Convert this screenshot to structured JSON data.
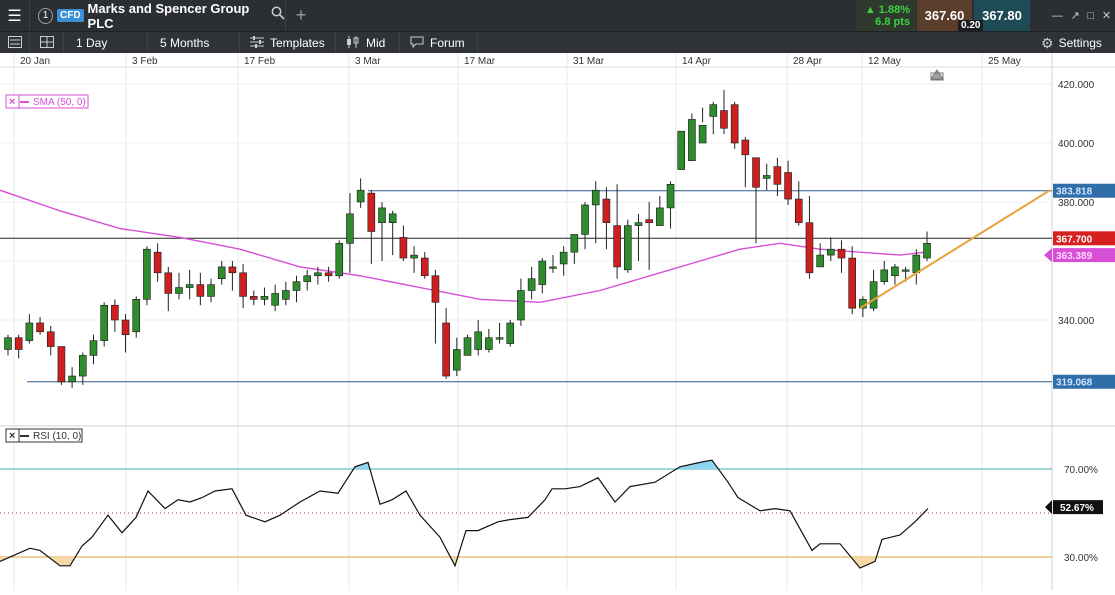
{
  "instrument": {
    "order": "1",
    "badge": "CFD",
    "name": "Marks and Spencer Group PLC"
  },
  "quote": {
    "change_pct": "1.88%",
    "change_pts": "6.8 pts",
    "sell": "367.60",
    "buy": "367.80",
    "spread": "0.20"
  },
  "toolbar": {
    "interval": "1 Day",
    "range": "5 Months",
    "templates": "Templates",
    "price_type": "Mid",
    "forum": "Forum",
    "settings": "Settings"
  },
  "colors": {
    "up": "#2e8b2e",
    "down": "#cc2020",
    "sma": "#d64fd6",
    "trendline": "#e8a23a",
    "overbought": "#8fd3f0",
    "oversold": "#f7d9a8"
  },
  "x_axis": [
    "20 Jan",
    "3 Feb",
    "17 Feb",
    "3 Mar",
    "17 Mar",
    "31 Mar",
    "14 Apr",
    "28 Apr",
    "12 May",
    "25 May"
  ],
  "price_axis": [
    "420.000",
    "400.000",
    "380.000",
    "340.000"
  ],
  "price_labels": {
    "current": "367.700",
    "upper_line": "383.818",
    "sma": "363.389",
    "lower_line": "319.068"
  },
  "sma_legend": "SMA (50, 0)",
  "rsi_legend": "RSI (10, 0)",
  "rsi_axis": [
    "70.00%",
    "30.00%"
  ],
  "rsi_current": "52.67%",
  "chart_data": {
    "type": "candlestick",
    "ylim": [
      310,
      426
    ],
    "candles": [
      [
        330,
        334,
        328,
        335
      ],
      [
        334,
        330,
        327,
        335
      ],
      [
        333,
        339,
        332,
        342
      ],
      [
        339,
        336,
        335,
        341
      ],
      [
        336,
        331,
        328,
        338
      ],
      [
        331,
        319,
        318,
        331
      ],
      [
        319,
        321,
        317,
        324
      ],
      [
        321,
        328,
        318,
        329
      ],
      [
        328,
        333,
        325,
        335
      ],
      [
        333,
        345,
        331,
        346
      ],
      [
        345,
        340,
        336,
        347
      ],
      [
        340,
        335,
        329,
        342
      ],
      [
        336,
        347,
        334,
        348
      ],
      [
        347,
        364,
        345,
        365
      ],
      [
        363,
        356,
        353,
        366
      ],
      [
        356,
        349,
        343,
        358
      ],
      [
        349,
        351,
        347,
        356
      ],
      [
        351,
        352,
        347,
        357
      ],
      [
        352,
        348,
        345,
        356
      ],
      [
        348,
        352,
        346,
        354
      ],
      [
        354,
        358,
        352,
        360
      ],
      [
        358,
        356,
        350,
        360
      ],
      [
        356,
        348,
        344,
        359
      ],
      [
        348,
        347,
        345,
        350
      ],
      [
        347,
        348,
        345,
        351
      ],
      [
        345,
        349,
        343,
        352
      ],
      [
        347,
        350,
        345,
        353
      ],
      [
        350,
        353,
        346,
        355
      ],
      [
        353,
        355,
        350,
        357
      ],
      [
        355,
        356,
        352,
        358
      ],
      [
        356,
        355,
        353,
        358
      ],
      [
        355,
        366,
        354,
        367
      ],
      [
        366,
        376,
        356,
        383
      ],
      [
        380,
        384,
        378,
        388
      ],
      [
        383,
        370,
        359,
        384
      ],
      [
        373,
        378,
        360,
        380
      ],
      [
        373,
        376,
        362,
        377
      ],
      [
        368,
        361,
        360,
        372
      ],
      [
        361,
        362,
        356,
        365
      ],
      [
        361,
        355,
        354,
        363
      ],
      [
        355,
        346,
        332,
        357
      ],
      [
        339,
        321,
        320,
        344
      ],
      [
        323,
        330,
        321,
        334
      ],
      [
        328,
        334,
        328,
        335
      ],
      [
        330,
        336,
        328,
        340
      ],
      [
        330,
        334,
        329,
        337
      ],
      [
        334,
        334,
        332,
        339
      ],
      [
        332,
        339,
        331,
        340
      ],
      [
        340,
        350,
        338,
        354
      ],
      [
        350,
        354,
        347,
        358
      ],
      [
        352,
        360,
        349,
        361
      ],
      [
        358,
        358,
        356,
        362
      ],
      [
        359,
        363,
        355,
        365
      ],
      [
        363,
        369,
        359,
        369
      ],
      [
        369,
        379,
        364,
        380
      ],
      [
        379,
        384,
        366,
        387
      ],
      [
        381,
        373,
        364,
        385
      ],
      [
        372,
        358,
        354,
        386
      ],
      [
        357,
        372,
        356,
        374
      ],
      [
        372,
        373,
        360,
        376
      ],
      [
        374,
        373,
        357,
        380
      ],
      [
        372,
        378,
        373,
        382
      ],
      [
        378,
        386,
        371,
        387
      ],
      [
        391,
        404,
        392,
        396
      ],
      [
        394,
        408,
        401,
        410
      ],
      [
        400,
        406,
        407,
        412
      ],
      [
        409,
        413,
        403,
        414
      ],
      [
        411,
        405,
        403,
        418
      ],
      [
        413,
        400,
        398,
        414
      ],
      [
        401,
        396,
        385,
        402
      ],
      [
        395,
        385,
        366,
        395
      ],
      [
        388,
        389,
        384,
        393
      ],
      [
        392,
        386,
        382,
        395
      ],
      [
        390,
        381,
        379,
        394
      ],
      [
        381,
        373,
        372,
        387
      ],
      [
        373,
        356,
        354,
        382
      ],
      [
        358,
        362,
        358,
        366
      ],
      [
        362,
        364,
        360,
        368
      ],
      [
        364,
        361,
        356,
        367
      ],
      [
        361,
        344,
        342,
        365
      ],
      [
        344,
        347,
        341,
        348
      ],
      [
        344,
        353,
        343,
        357
      ],
      [
        353,
        357,
        352,
        360
      ],
      [
        355,
        358,
        352,
        359
      ],
      [
        357,
        357,
        353,
        358
      ],
      [
        356,
        362,
        352,
        364
      ],
      [
        361,
        366,
        360,
        370
      ]
    ],
    "sma": [
      [
        0,
        384
      ],
      [
        60,
        377
      ],
      [
        120,
        371
      ],
      [
        180,
        368
      ],
      [
        240,
        364
      ],
      [
        300,
        358
      ],
      [
        360,
        355
      ],
      [
        420,
        351
      ],
      [
        480,
        347
      ],
      [
        540,
        346
      ],
      [
        600,
        350
      ],
      [
        660,
        356
      ],
      [
        700,
        360
      ],
      [
        740,
        364
      ],
      [
        780,
        366
      ],
      [
        820,
        364
      ],
      [
        860,
        363
      ],
      [
        900,
        362
      ],
      [
        925,
        363
      ]
    ],
    "horizontal_lines": [
      383.818,
      367.7,
      319.068
    ],
    "trendline": [
      [
        860,
        344
      ],
      [
        1050,
        384
      ]
    ],
    "rsi": [
      [
        0,
        28
      ],
      [
        30,
        34
      ],
      [
        40,
        33
      ],
      [
        60,
        26
      ],
      [
        70,
        26
      ],
      [
        82,
        35
      ],
      [
        92,
        39
      ],
      [
        108,
        49
      ],
      [
        122,
        41
      ],
      [
        136,
        48
      ],
      [
        148,
        60
      ],
      [
        165,
        52
      ],
      [
        178,
        56
      ],
      [
        190,
        55
      ],
      [
        202,
        57
      ],
      [
        215,
        60
      ],
      [
        232,
        61
      ],
      [
        246,
        49
      ],
      [
        265,
        46
      ],
      [
        280,
        49
      ],
      [
        300,
        55
      ],
      [
        320,
        60
      ],
      [
        338,
        59
      ],
      [
        355,
        71
      ],
      [
        368,
        73
      ],
      [
        380,
        54
      ],
      [
        392,
        56
      ],
      [
        406,
        60
      ],
      [
        420,
        49
      ],
      [
        440,
        39
      ],
      [
        455,
        26
      ],
      [
        466,
        42
      ],
      [
        478,
        42
      ],
      [
        498,
        46
      ],
      [
        510,
        47
      ],
      [
        528,
        48
      ],
      [
        545,
        56
      ],
      [
        552,
        61
      ],
      [
        565,
        61
      ],
      [
        580,
        62
      ],
      [
        598,
        66
      ],
      [
        615,
        55
      ],
      [
        630,
        62
      ],
      [
        655,
        64
      ],
      [
        680,
        71
      ],
      [
        700,
        73
      ],
      [
        712,
        74
      ],
      [
        728,
        64
      ],
      [
        738,
        57
      ],
      [
        760,
        51
      ],
      [
        775,
        52
      ],
      [
        790,
        51
      ],
      [
        812,
        33
      ],
      [
        820,
        36
      ],
      [
        840,
        36
      ],
      [
        860,
        25
      ],
      [
        875,
        28
      ],
      [
        882,
        38
      ],
      [
        900,
        40
      ],
      [
        915,
        46
      ],
      [
        928,
        52
      ]
    ],
    "rsi_levels": [
      70,
      30
    ],
    "rsi_ylim": [
      18,
      88
    ]
  }
}
